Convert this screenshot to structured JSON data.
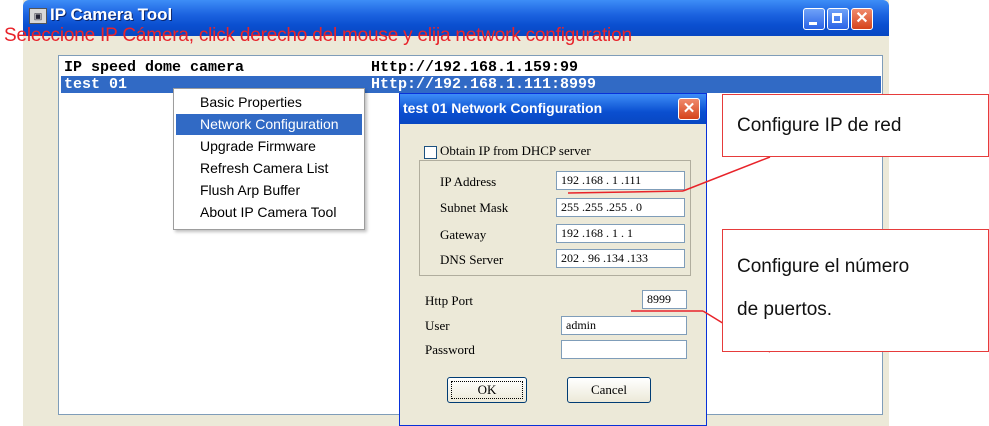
{
  "window": {
    "title": "IP Camera Tool",
    "icon": "camera-app-icon"
  },
  "banner": "Seleccione IP Cámera, click derecho del mouse y elija network configuration",
  "camera_list": [
    {
      "name": "IP speed dome camera",
      "url": "Http://192.168.1.159:99"
    },
    {
      "name": "test 01",
      "url": "Http://192.168.1.111:8999"
    }
  ],
  "context_menu": {
    "items": [
      "Basic Properties",
      "Network Configuration",
      "Upgrade Firmware",
      "Refresh Camera List",
      "Flush Arp Buffer",
      "About IP Camera Tool"
    ],
    "highlighted": "Network Configuration"
  },
  "dialog": {
    "title": "test 01 Network Configuration",
    "dhcp_label": "Obtain IP from DHCP server",
    "dhcp_checked": false,
    "fields": {
      "ip": {
        "label": "IP Address",
        "value": "192 .168 . 1  .111"
      },
      "mask": {
        "label": "Subnet Mask",
        "value": "255 .255 .255 . 0"
      },
      "gateway": {
        "label": "Gateway",
        "value": "192 .168 . 1  . 1"
      },
      "dns": {
        "label": "DNS Server",
        "value": "202 . 96 .134 .133"
      }
    },
    "http_port": {
      "label": "Http Port",
      "value": "8999"
    },
    "user": {
      "label": "User",
      "value": "admin"
    },
    "password": {
      "label": "Password",
      "value": ""
    },
    "ok_label": "OK",
    "cancel_label": "Cancel"
  },
  "annotations": {
    "ip": "Configure IP de red",
    "ports_line1": "Configure el número",
    "ports_line2": "de puertos."
  },
  "colors": {
    "annotation_red": "#e8232a",
    "selection_blue": "#316ac5",
    "xp_title_blue": "#0a4fd0"
  }
}
